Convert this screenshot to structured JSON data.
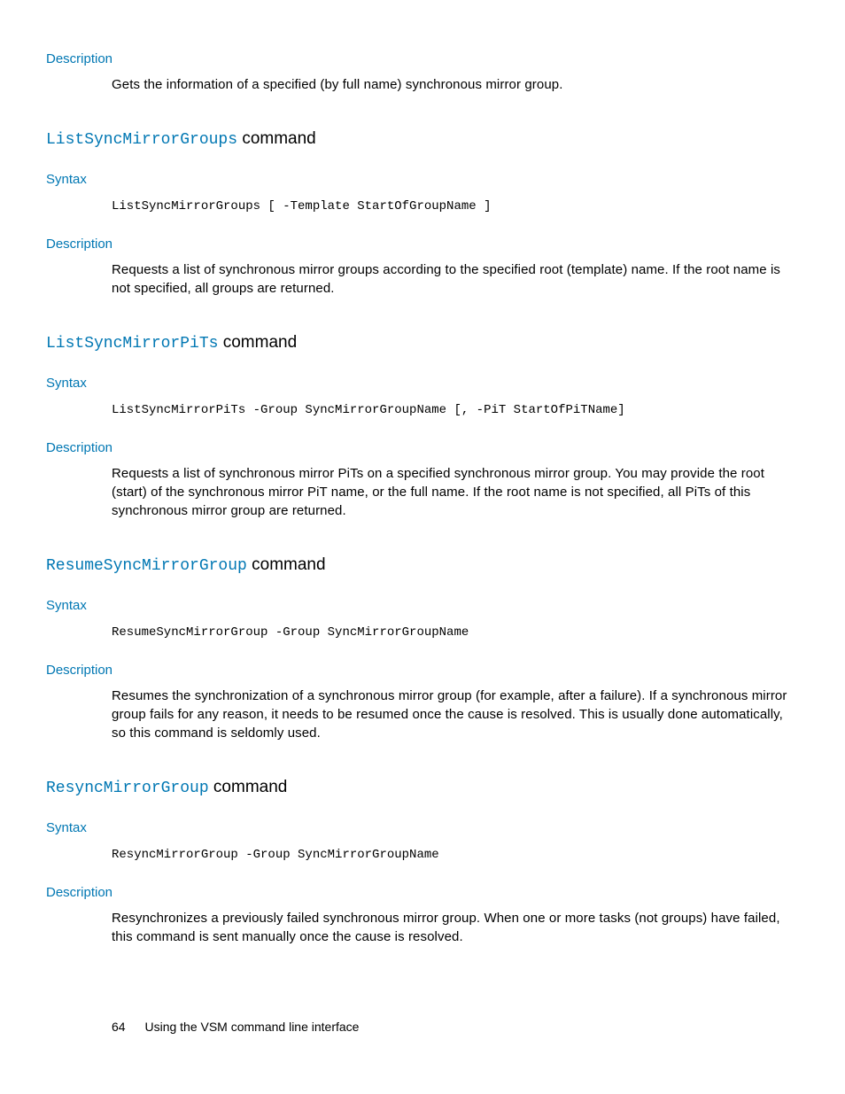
{
  "sections": [
    {
      "desc_label": "Description",
      "desc_text": "Gets the information of a specified (by full name) synchronous mirror group."
    },
    {
      "title_mono": "ListSyncMirrorGroups",
      "title_suffix": " command",
      "syntax_label": "Syntax",
      "syntax_code": "ListSyncMirrorGroups [ -Template StartOfGroupName ]",
      "desc_label": "Description",
      "desc_text": "Requests a list of synchronous mirror groups according to the specified root (template) name. If the root name is not specified, all groups are returned."
    },
    {
      "title_mono": "ListSyncMirrorPiTs",
      "title_suffix": " command",
      "syntax_label": "Syntax",
      "syntax_code": "ListSyncMirrorPiTs -Group SyncMirrorGroupName [, -PiT StartOfPiTName]",
      "desc_label": "Description",
      "desc_text": "Requests a list of synchronous mirror PiTs on a specified synchronous mirror group. You may provide the root (start) of the synchronous mirror PiT name, or the full name. If the root name is not specified, all PiTs of this synchronous mirror group are returned."
    },
    {
      "title_mono": "ResumeSyncMirrorGroup",
      "title_suffix": " command",
      "syntax_label": "Syntax",
      "syntax_code": "ResumeSyncMirrorGroup -Group SyncMirrorGroupName",
      "desc_label": "Description",
      "desc_text": "Resumes the synchronization of a synchronous mirror group (for example, after a failure). If a synchronous mirror group fails for any reason, it needs to be resumed once the cause is resolved. This is usually done automatically, so this command is seldomly used."
    },
    {
      "title_mono": "ResyncMirrorGroup",
      "title_suffix": " command",
      "syntax_label": "Syntax",
      "syntax_code": "ResyncMirrorGroup -Group SyncMirrorGroupName",
      "desc_label": "Description",
      "desc_text": "Resynchronizes a previously failed synchronous mirror group. When one or more tasks (not groups) have failed, this command is sent manually once the cause is resolved."
    }
  ],
  "footer": {
    "page_number": "64",
    "chapter": "Using the VSM command line interface"
  }
}
